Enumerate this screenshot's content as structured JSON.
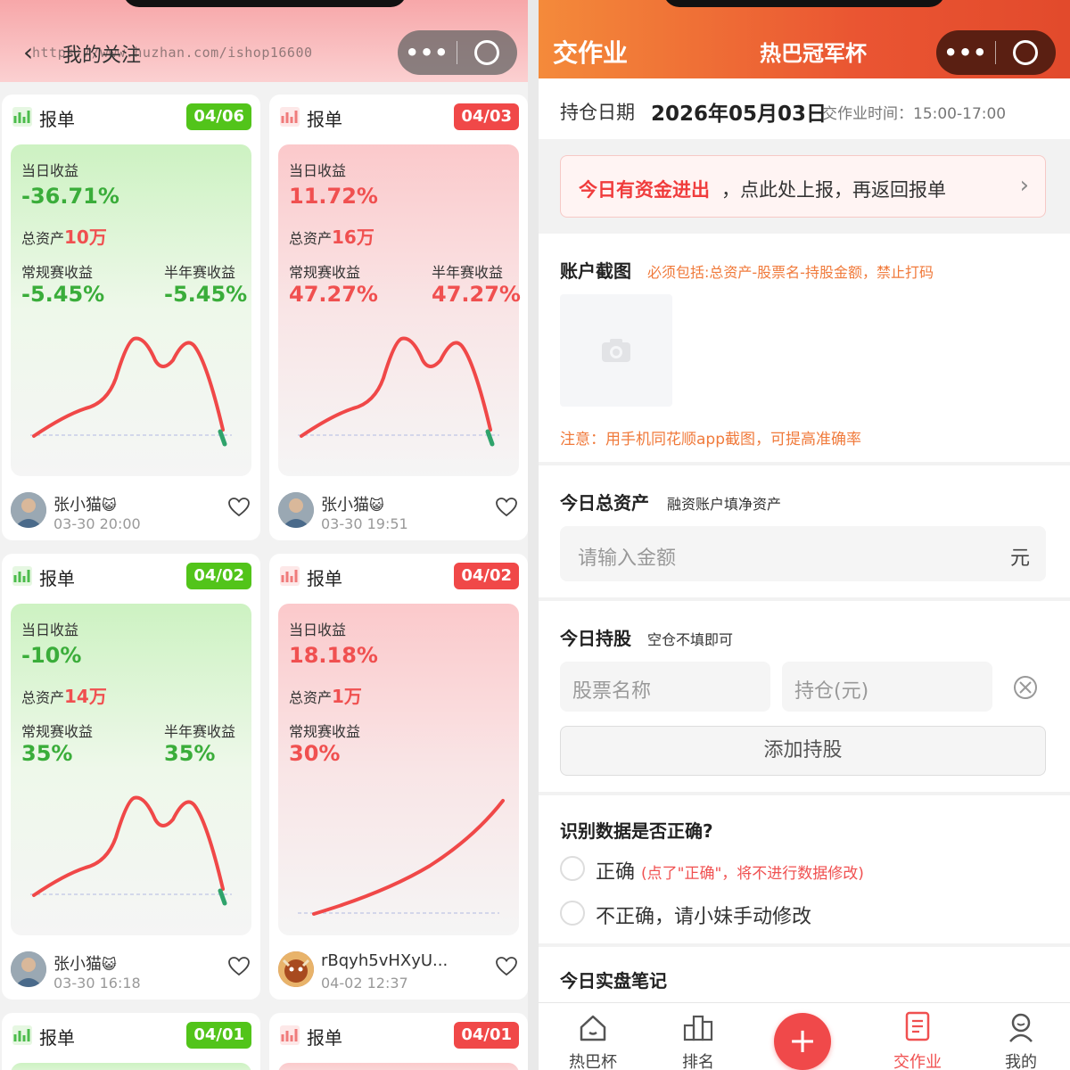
{
  "left": {
    "title": "我的关注",
    "watermark": "https://www.huzhan.com/ishop16600",
    "cards": [
      {
        "type": "报单",
        "date": "04/06",
        "tone": "green",
        "day_label": "当日收益",
        "day_value": "-36.71%",
        "asset_prefix": "总资产",
        "asset_value": "10万",
        "reg_label": "常规赛收益",
        "reg_value": "-5.45%",
        "half_label": "半年赛收益",
        "half_value": "-5.45%",
        "user": "张小猫",
        "emoji": "😺",
        "time": "03-30 20:00",
        "curve": "hump"
      },
      {
        "type": "报单",
        "date": "04/03",
        "tone": "red",
        "day_label": "当日收益",
        "day_value": "11.72%",
        "asset_prefix": "总资产",
        "asset_value": "16万",
        "reg_label": "常规赛收益",
        "reg_value": "47.27%",
        "half_label": "半年赛收益",
        "half_value": "47.27%",
        "user": "张小猫",
        "emoji": "😺",
        "time": "03-30 19:51",
        "curve": "hump"
      },
      {
        "type": "报单",
        "date": "04/02",
        "tone": "green",
        "day_label": "当日收益",
        "day_value": "-10%",
        "asset_prefix": "总资产",
        "asset_value": "14万",
        "reg_label": "常规赛收益",
        "reg_value": "35%",
        "half_label": "半年赛收益",
        "half_value": "35%",
        "user": "张小猫",
        "emoji": "😺",
        "time": "03-30 16:18",
        "curve": "hump"
      },
      {
        "type": "报单",
        "date": "04/02",
        "tone": "red",
        "day_label": "当日收益",
        "day_value": "18.18%",
        "asset_prefix": "总资产",
        "asset_value": "1万",
        "reg_label": "常规赛收益",
        "reg_value": "30%",
        "half_label": "",
        "half_value": "",
        "user": "rBqyh5vHXyU...",
        "emoji": "",
        "time": "04-02 12:37",
        "curve": "rise"
      },
      {
        "type": "报单",
        "date": "04/01",
        "tone": "green"
      },
      {
        "type": "报单",
        "date": "04/01",
        "tone": "red"
      }
    ]
  },
  "right": {
    "title_left": "交作业",
    "title_center": "热巴冠军杯",
    "hold_date_label": "持仓日期",
    "hold_date": "2026年05月03日",
    "submit_time": "交作业时间：15:00-17:00",
    "notice_strong": "今日有资金进出",
    "notice_rest": "，点此处上报，再返回报单",
    "notice_arrow": "›",
    "screenshot_label": "账户截图",
    "screenshot_hint": "必须包括:总资产-股票名-持股金额，禁止打码",
    "screenshot_note": "注意：用手机同花顺app截图，可提高准确率",
    "total_label": "今日总资产",
    "total_hint": "融资账户填净资产",
    "total_placeholder": "请输入金额",
    "total_unit": "元",
    "holdings_label": "今日持股",
    "holdings_hint": "空仓不填即可",
    "stock_placeholder": "股票名称",
    "amount_placeholder": "持仓(元)",
    "add_button": "添加持股",
    "verify_label": "识别数据是否正确?",
    "opt_correct": "正确",
    "opt_correct_note": "(点了\"正确\"，将不进行数据修改)",
    "opt_wrong": "不正确，请小妹手动修改",
    "notes_label": "今日实盘笔记"
  },
  "tabbar": [
    {
      "label": "热巴杯",
      "icon": "home-icon",
      "active": false
    },
    {
      "label": "排名",
      "icon": "ranking-icon",
      "active": false
    },
    {
      "label": "+",
      "icon": "plus-icon",
      "active": false
    },
    {
      "label": "交作业",
      "icon": "document-icon",
      "active": true
    },
    {
      "label": "我的",
      "icon": "user-icon",
      "active": false
    }
  ],
  "colors": {
    "accent": "#f05050",
    "green": "#3aad3a",
    "orange": "#f07a3b",
    "header_red": "#ea5532"
  }
}
